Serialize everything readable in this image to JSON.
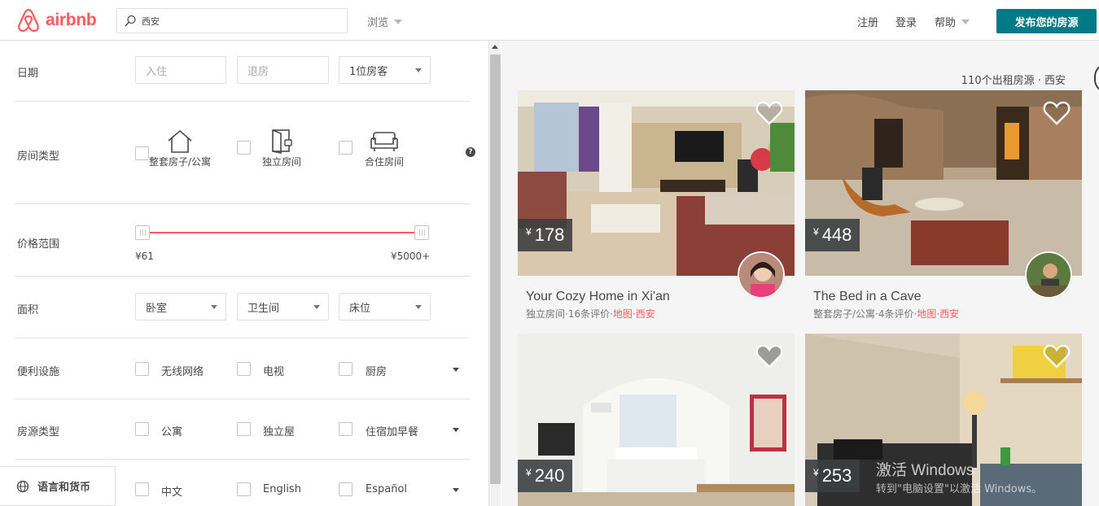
{
  "header": {
    "brand": "airbnb",
    "search_value": "西安",
    "browse_label": "浏览",
    "signup_label": "注册",
    "login_label": "登录",
    "help_label": "帮助",
    "publish_label": "发布您的房源"
  },
  "filters": {
    "dates": {
      "label": "日期",
      "checkin_placeholder": "入住",
      "checkout_placeholder": "退房",
      "guests_value": "1位房客"
    },
    "room_type": {
      "label": "房间类型",
      "options": [
        "整套房子/公寓",
        "独立房间",
        "合住房间"
      ],
      "help": "?"
    },
    "price": {
      "label": "价格范围",
      "min_label": "¥61",
      "max_label": "¥5000+",
      "min_fraction": 0,
      "max_fraction": 1
    },
    "size": {
      "label": "面积",
      "bedrooms": "卧室",
      "bathrooms": "卫生间",
      "beds": "床位"
    },
    "amenities": {
      "label": "便利设施",
      "options": [
        "无线网络",
        "电视",
        "厨房"
      ]
    },
    "property_type": {
      "label": "房源类型",
      "options": [
        "公寓",
        "独立屋",
        "住宿加早餐"
      ]
    },
    "languages": {
      "options": [
        "中文",
        "English",
        "Español"
      ]
    },
    "lang_currency_label": "语言和货币"
  },
  "results": {
    "count_text": "110个出租房源 · 西安",
    "listings": [
      {
        "price": "178",
        "currency": "¥",
        "title": "Your Cozy Home in Xi'an",
        "meta": "独立房间·16条评价·",
        "map_link": "地图·西安"
      },
      {
        "price": "448",
        "currency": "¥",
        "title": "The Bed in a Cave",
        "meta": "整套房子/公寓·4条评价·",
        "map_link": "地图·西安"
      },
      {
        "price": "240",
        "currency": "¥",
        "title": "",
        "meta": "",
        "map_link": ""
      },
      {
        "price": "253",
        "currency": "¥",
        "title": "",
        "meta": "",
        "map_link": ""
      }
    ]
  },
  "watermark": {
    "line1": "激活 Windows",
    "line2": "转到\"电脑设置\"以激活 Windows。"
  },
  "colors": {
    "brand": "#ff5a5f",
    "teal": "#007a87"
  }
}
